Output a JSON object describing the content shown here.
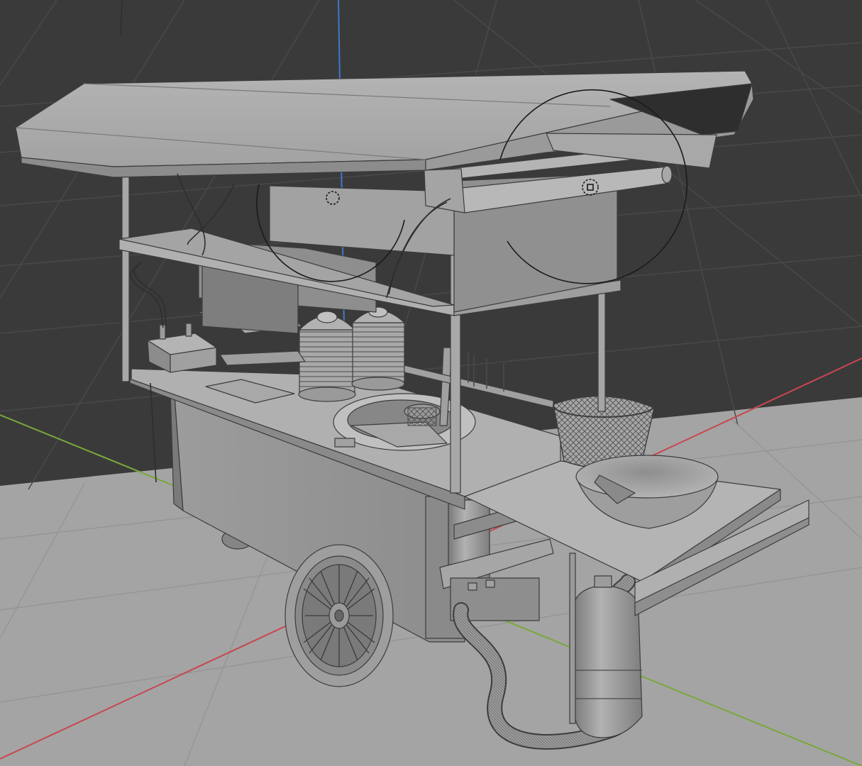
{
  "viewport": {
    "background": "#3a3a3a",
    "floor_color": "#a4a4a4",
    "grid_color": "#4a4a4a",
    "x_axis_color": "#c8474f",
    "y_axis_color": "#79a83a",
    "z_axis_color": "#3f78c8"
  },
  "scene": {
    "object": "food-cart-model",
    "material_color": "#9a9a9a",
    "edge_color": "#3c3c3c",
    "light_gizmo_color": "#1a1a1a"
  }
}
